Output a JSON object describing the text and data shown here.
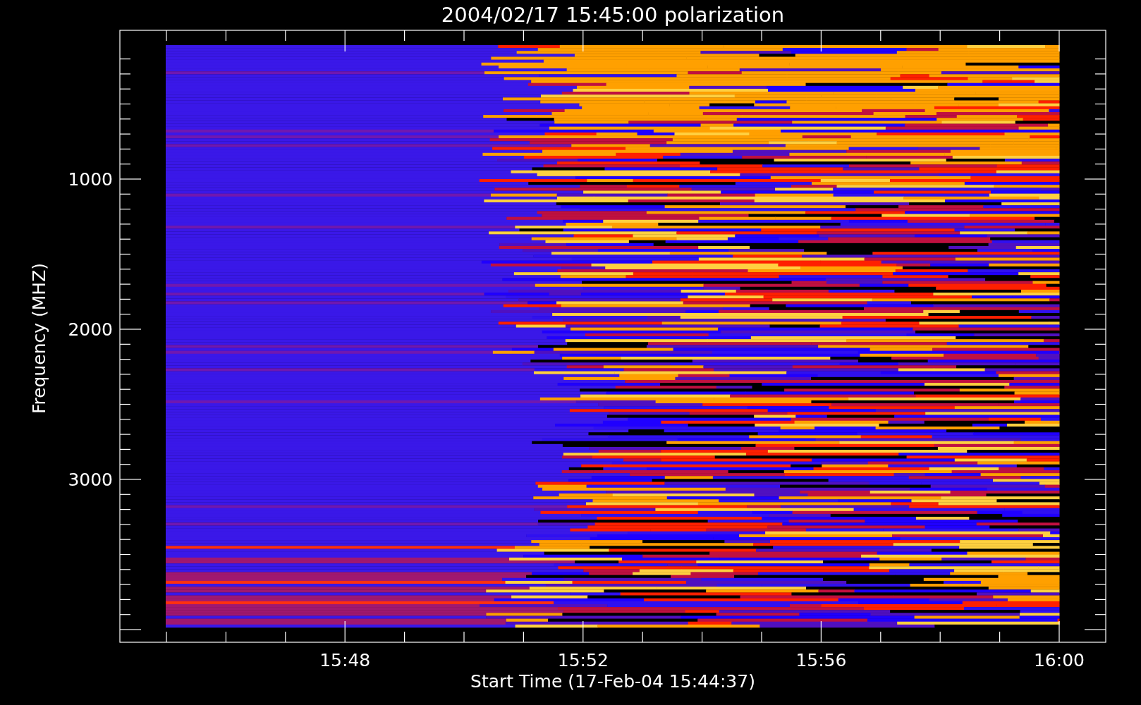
{
  "plot": {
    "title": "2004/02/17 15:45:00 polarization",
    "xlabel": "Start Time (17-Feb-04 15:44:37)",
    "ylabel": "Frequency (MHZ)",
    "xticks": [
      "15:48",
      "15:52",
      "15:56",
      "16:00"
    ],
    "yticks": [
      "1000",
      "2000",
      "3000"
    ]
  }
}
